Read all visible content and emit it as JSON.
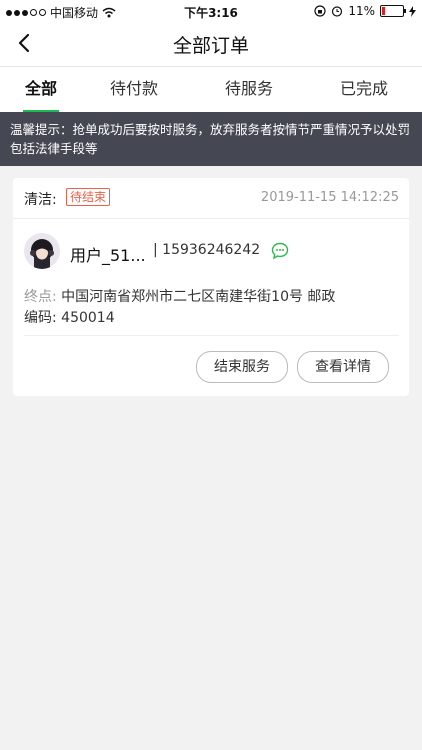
{
  "status_bar": {
    "carrier": "中国移动",
    "time": "下午3:16",
    "battery": "11%",
    "colors": {
      "battery_low": "#e02020"
    }
  },
  "nav": {
    "title": "全部订单",
    "back_icon": "chevron-left-icon"
  },
  "tabs": [
    {
      "label": "全部",
      "active": true
    },
    {
      "label": "待付款",
      "active": false
    },
    {
      "label": "待服务",
      "active": false
    },
    {
      "label": "已完成",
      "active": false
    }
  ],
  "notice": {
    "text": "温馨提示：抢单成功后要按时服务，放弃服务者按情节严重情况予以处罚包括法律手段等"
  },
  "order": {
    "type_label": "清洁:",
    "status": "待结束",
    "time": "2019-11-15 14:12:25",
    "user_name": "用户_51...",
    "phone": "| 15936246242",
    "destination_label": "终点:",
    "destination": "中国河南省郑州市二七区南建华街10号 邮政编码: 450014",
    "buttons": {
      "end": "结束服务",
      "detail": "查看详情"
    }
  },
  "colors": {
    "accent": "#1db954",
    "status_badge": "#e8614a",
    "notice_bg": "#454853"
  }
}
